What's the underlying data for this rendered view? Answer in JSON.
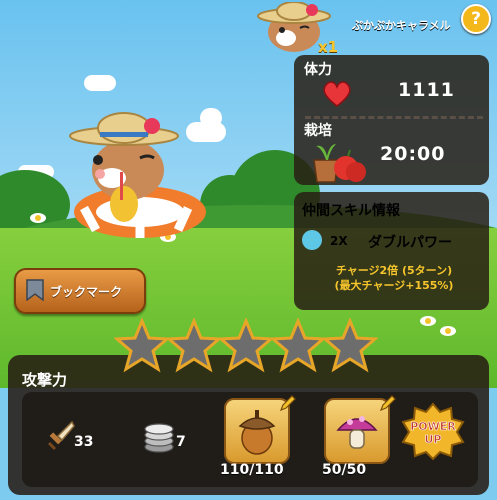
{
  "character": {
    "name": "ぷかぷかキャラメル",
    "multiplier": "x1",
    "help_label": "?"
  },
  "status": {
    "hp_label": "体力",
    "hp_value": "1111",
    "cultivation_label": "栽培",
    "cultivation_time": "20:00"
  },
  "skill": {
    "title": "仲間スキル情報",
    "level_label": "2X",
    "name": "ダブルパワー",
    "charge_line1": "チャージ2倍 (5ターン)",
    "charge_line2": "(最大チャージ+155%)"
  },
  "bookmark": {
    "label": "ブックマーク"
  },
  "stars": {
    "filled": 0,
    "total": 5
  },
  "attack": {
    "label": "攻撃力",
    "sword_value": "33",
    "coin_value": "7",
    "acorn_count": "110/110",
    "mushroom_count": "50/50",
    "powerup_line1": "POWER",
    "powerup_line2": "UP"
  },
  "colors": {
    "panel": "#2a1e14",
    "accent_gold": "#f6c52c",
    "grass": "#6cc231",
    "sky": "#7ecbf0"
  }
}
